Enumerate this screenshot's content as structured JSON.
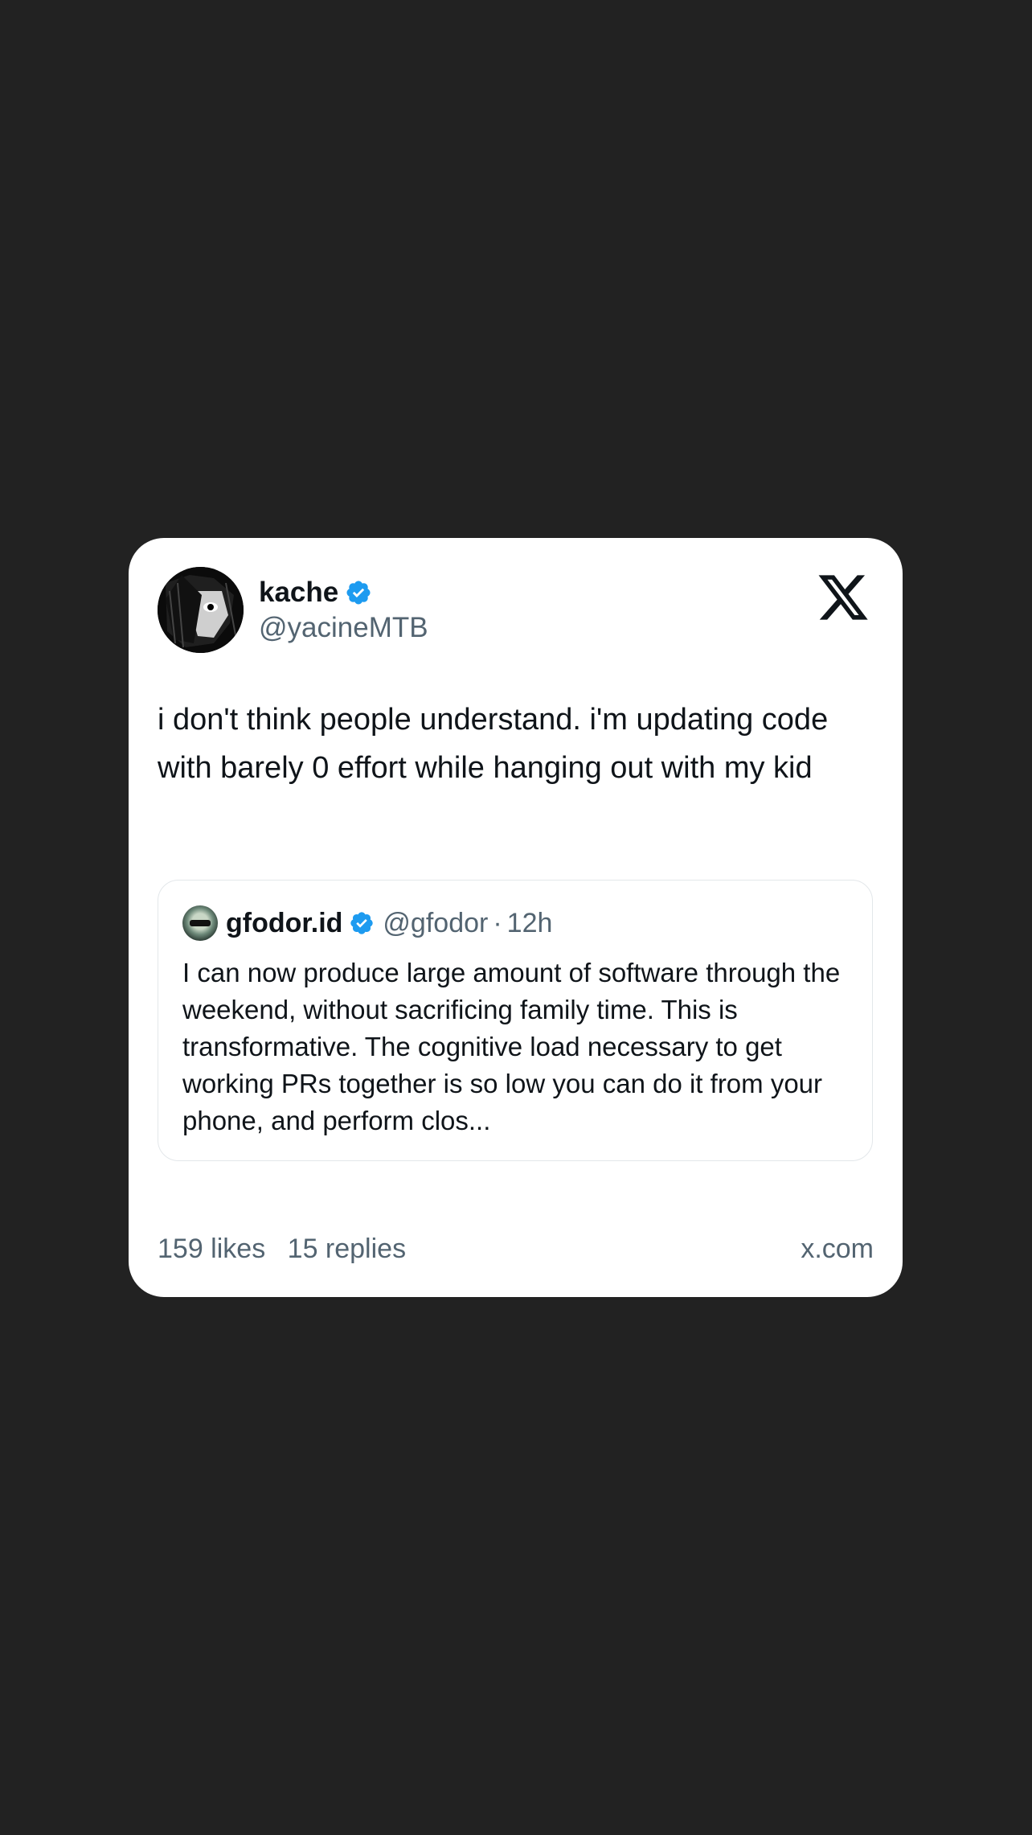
{
  "post": {
    "author": {
      "display_name": "kache",
      "handle": "@yacineMTB",
      "verified": true
    },
    "text": "i don't think people understand. i'm updating code with barely 0 effort while hanging out with my kid",
    "quote": {
      "author": {
        "display_name": "gfodor.id",
        "handle": "@gfodor",
        "verified": true
      },
      "separator": "·",
      "time": "12h",
      "text": "I can now produce large amount of software through the weekend, without sacrificing family time. This is transformative. The cognitive load necessary to get working PRs together is so low you can do it from your phone, and perform clos..."
    },
    "stats": {
      "likes": "159 likes",
      "replies": "15 replies"
    },
    "source": "x.com"
  },
  "icons": {
    "verified": "verified-badge-icon",
    "brand": "x-logo-icon"
  },
  "colors": {
    "background": "#222222",
    "card": "#ffffff",
    "verified_blue": "#1d9bf0",
    "secondary_text": "#536471",
    "primary_text": "#0f1419"
  }
}
